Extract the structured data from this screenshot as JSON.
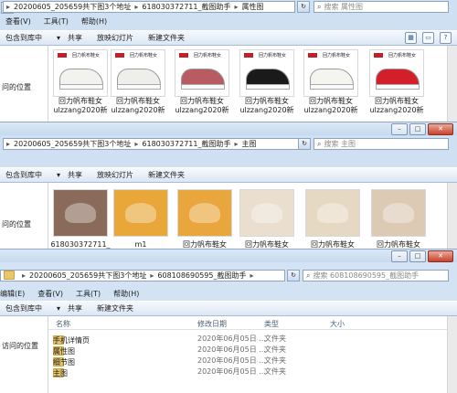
{
  "window1": {
    "address_path": [
      "20200605_205659共下图3个地址",
      "618030372711_截图助手",
      "属性图"
    ],
    "search_placeholder": "搜索 属性图",
    "menu": [
      "查看(V)",
      "工具(T)",
      "帮助(H)"
    ],
    "toolbar": [
      "包含到库中",
      "共享",
      "放映幻灯片",
      "新建文件夹"
    ],
    "nav_items": [
      "",
      "",
      "",
      "问的位置",
      "",
      ""
    ],
    "thumb_text": "回力帆布鞋女",
    "files": [
      {
        "label1": "回力帆布鞋女",
        "label2": "ulzzang2020新",
        "shoe_color": "#f2f2ee"
      },
      {
        "label1": "回力帆布鞋女",
        "label2": "ulzzang2020新",
        "shoe_color": "#eeeeea"
      },
      {
        "label1": "回力帆布鞋女",
        "label2": "ulzzang2020新",
        "shoe_color": "#b85c62"
      },
      {
        "label1": "回力帆布鞋女",
        "label2": "ulzzang2020新",
        "shoe_color": "#1a1a1a"
      },
      {
        "label1": "回力帆布鞋女",
        "label2": "ulzzang2020新",
        "shoe_color": "#f5f5f0"
      },
      {
        "label1": "回力帆布鞋女",
        "label2": "ulzzang2020新",
        "shoe_color": "#d21f2a"
      }
    ]
  },
  "window2": {
    "address_path": [
      "20200605_205659共下图3个地址",
      "618030372711_截图助手",
      "主图"
    ],
    "search_placeholder": "搜索 主图",
    "toolbar": [
      "包含到库中",
      "共享",
      "放映幻灯片",
      "新建文件夹"
    ],
    "nav_items": [
      "",
      "",
      "",
      "问的位置",
      "",
      ""
    ],
    "files": [
      {
        "label": "618030372711_",
        "bg": "#8a6a5a"
      },
      {
        "label": "m1",
        "bg": "#e9a73a"
      },
      {
        "label": "回力帆布鞋女",
        "bg": "#e8a63c"
      },
      {
        "label": "回力帆布鞋女",
        "bg": "#eadfcf"
      },
      {
        "label": "回力帆布鞋女",
        "bg": "#e6d9c4"
      },
      {
        "label": "回力帆布鞋女",
        "bg": "#dccab4"
      }
    ]
  },
  "window3": {
    "address_path": [
      "20200605_205659共下图3个地址",
      "608108690595_截图助手"
    ],
    "search_placeholder": "搜索 608108690595_截图助手",
    "menu": [
      "编辑(E)",
      "查看(V)",
      "工具(T)",
      "帮助(H)"
    ],
    "toolbar": [
      "包含到库中",
      "共享",
      "新建文件夹"
    ],
    "nav_items": [
      "",
      "",
      "访问的位置",
      "",
      ""
    ],
    "columns": [
      "名称",
      "修改日期",
      "类型",
      "大小"
    ],
    "rows": [
      {
        "name": "手机详情页",
        "date": "2020年06月05日 ...",
        "type": "文件夹",
        "size": ""
      },
      {
        "name": "属性图",
        "date": "2020年06月05日 ...",
        "type": "文件夹",
        "size": ""
      },
      {
        "name": "细节图",
        "date": "2020年06月05日 ...",
        "type": "文件夹",
        "size": ""
      },
      {
        "name": "主图",
        "date": "2020年06月05日 ...",
        "type": "文件夹",
        "size": ""
      }
    ]
  }
}
